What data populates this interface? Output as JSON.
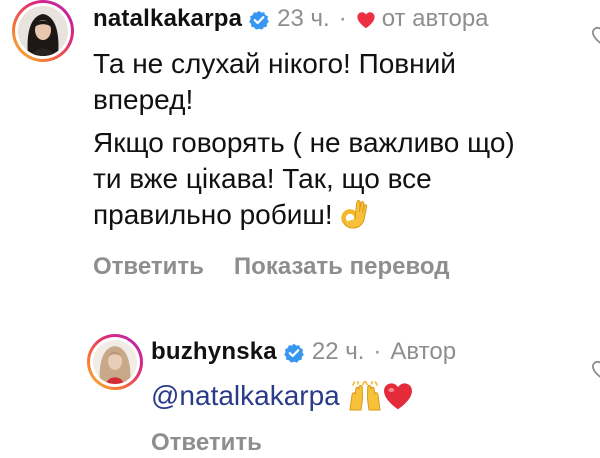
{
  "comments": [
    {
      "username": "natalkakarpa",
      "time": "23 ч.",
      "separator": "·",
      "author_like": "от автора",
      "paragraphs": [
        "Та не слухай нікого! Повний вперед!",
        "Якщо говорять ( не важливо що) ти вже цікава! Так, що все правильно робиш!"
      ],
      "reply_label": "Ответить",
      "translate_label": "Показать перевод"
    },
    {
      "username": "buzhynska",
      "time": "22 ч.",
      "separator": "·",
      "author_badge": "Автор",
      "mention": "@natalkakarpa",
      "reply_label": "Ответить"
    }
  ],
  "icons": {
    "verified": "verified-badge-icon",
    "author_heart": "heart-icon",
    "like": "heart-outline-icon",
    "ok_hand": "ok-hand-emoji",
    "raised_hands": "raising-hands-emoji",
    "red_heart": "red-heart-emoji"
  },
  "colors": {
    "verified_blue": "#3797f0",
    "author_heart_red": "#ed2f44",
    "mention_blue": "#2a3b88",
    "muted_gray": "#8e8e8e"
  }
}
